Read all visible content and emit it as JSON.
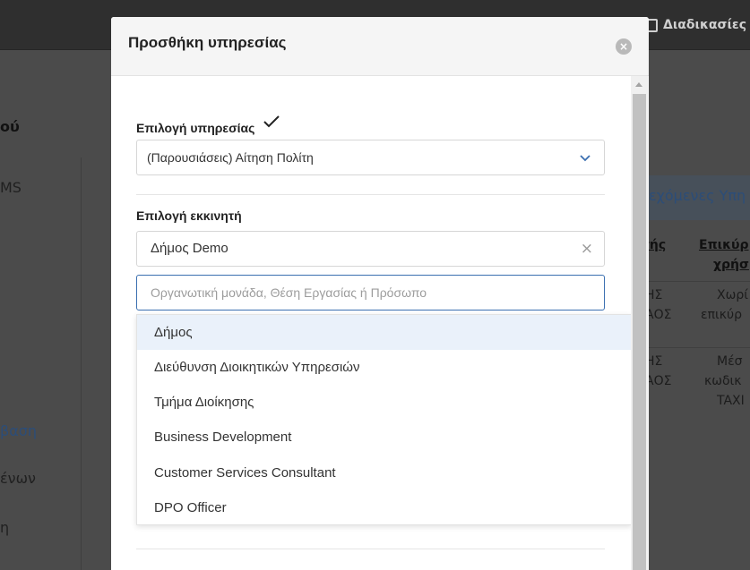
{
  "background": {
    "topbar": {
      "procedures_label": "Διαδικασίες"
    },
    "left_fragments": [
      "ού",
      "MS",
      "βαση",
      "ένων",
      "η"
    ],
    "right_tab": "εχόμενες Υπη",
    "right_headers": [
      "τής",
      "Επικύρ",
      "χρήσ"
    ],
    "right_cells": [
      [
        "ΗΣ",
        "ΑΟΣ",
        "Χωρί",
        "επικύρ"
      ],
      [
        "ΗΣ",
        "ΑΟΣ",
        "Μέσ",
        "κωδικ",
        "TAXI"
      ]
    ]
  },
  "modal": {
    "title": "Προσθήκη υπηρεσίας",
    "close_icon": "×",
    "service_field": {
      "label": "Επιλογή υπηρεσίας",
      "value": "(Παρουσιάσεις) Αίτηση Πολίτη"
    },
    "requester_field": {
      "label": "Επιλογή εκκινητή",
      "selected_value": "Δήμος Demo",
      "clear_icon": "×",
      "search_placeholder": "Οργανωτική μονάδα, Θέση Εργασίας ή Πρόσωπο",
      "search_value": ""
    },
    "dropdown_options": [
      "Δήμος",
      "Διεύθυνση Διοικητικών Υπηρεσιών",
      "Τμήμα Διοίκησης",
      "Business Development",
      "Customer Services Consultant",
      "DPO Officer"
    ],
    "active_option_index": 0
  },
  "colors": {
    "accent": "#3b6fb0",
    "highlight": "#eaf1fa",
    "overlay": "#4a4a4a"
  }
}
